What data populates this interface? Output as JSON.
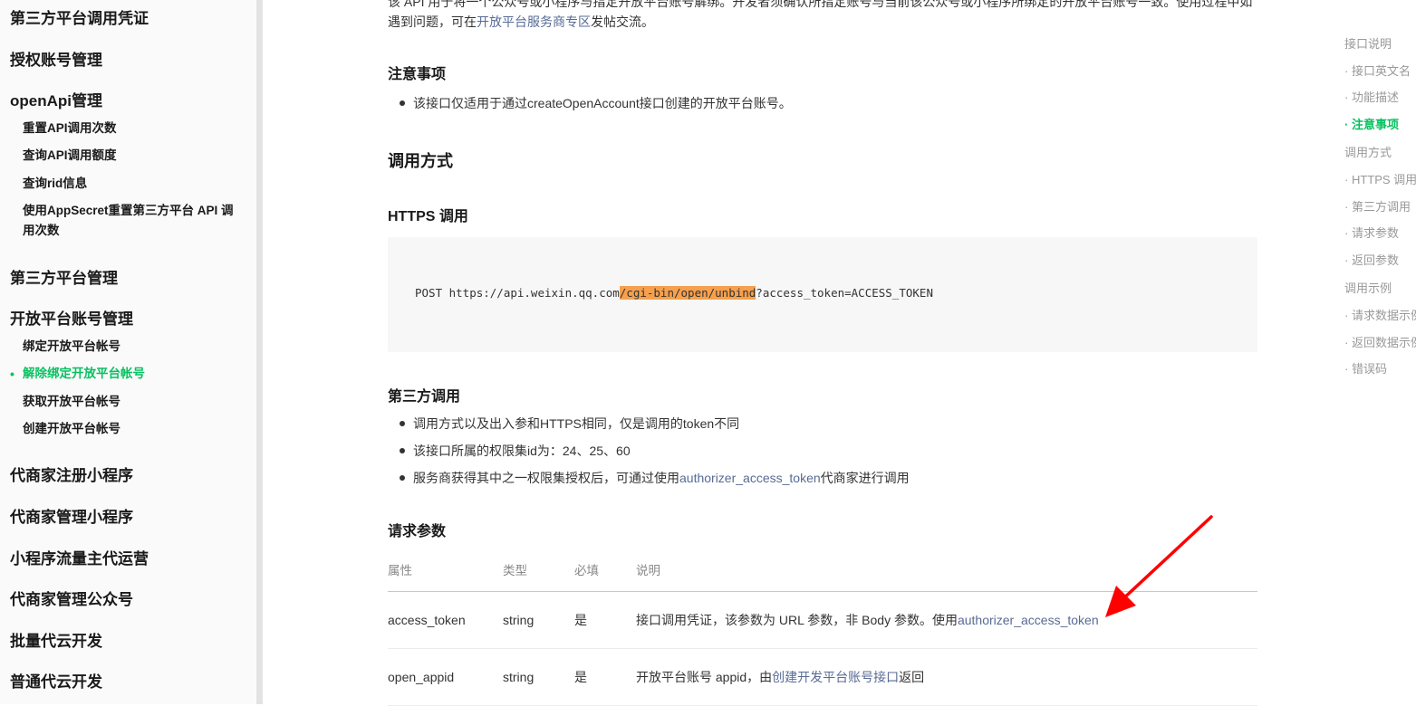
{
  "sidebar": {
    "sections": [
      {
        "label": "第三方平台调用凭证"
      },
      {
        "label": "授权账号管理"
      },
      {
        "label": "openApi管理"
      },
      {
        "label": "第三方平台管理"
      },
      {
        "label": "开放平台账号管理"
      },
      {
        "label": "代商家注册小程序"
      },
      {
        "label": "代商家管理小程序"
      },
      {
        "label": "小程序流量主代运营"
      },
      {
        "label": "代商家管理公众号"
      },
      {
        "label": "批量代云开发"
      },
      {
        "label": "普通代云开发"
      }
    ],
    "openapi_items": [
      {
        "label": "重置API调用次数"
      },
      {
        "label": "查询API调用额度"
      },
      {
        "label": "查询rid信息"
      },
      {
        "label": "使用AppSecret重置第三方平台 API 调用次数"
      }
    ],
    "open_account_items": [
      {
        "label": "绑定开放平台帐号"
      },
      {
        "label": "解除绑定开放平台帐号"
      },
      {
        "label": "获取开放平台帐号"
      },
      {
        "label": "创建开放平台帐号"
      }
    ]
  },
  "main": {
    "intro_line1": "该 API 用于将一个公众号或小程序与指定开放平台账号解绑。开发者须确认所指定账号与当前该公众号或小程序所绑定的开放平台账号一致。使用过程中如",
    "intro_line2_prefix": "遇到问题，可在",
    "intro_link": "开放平台服务商专区",
    "intro_line2_suffix": "发帖交流。",
    "notes_heading": "注意事项",
    "notes": [
      "该接口仅适用于通过createOpenAccount接口创建的开放平台账号。"
    ],
    "call_heading": "调用方式",
    "https_heading": "HTTPS 调用",
    "code": {
      "prefix": "POST https://api.weixin.qq.com",
      "highlight": "/cgi-bin/open/unbind",
      "suffix": "?access_token=ACCESS_TOKEN"
    },
    "third_heading": "第三方调用",
    "third_items": {
      "item1": "调用方式以及出入参和HTTPS相同，仅是调用的token不同",
      "item2": "该接口所属的权限集id为：24、25、60",
      "item3_prefix": "服务商获得其中之一权限集授权后，可通过使用",
      "item3_link": "authorizer_access_token",
      "item3_suffix": "代商家进行调用"
    },
    "params_heading": "请求参数",
    "table": {
      "headers": [
        "属性",
        "类型",
        "必填",
        "说明"
      ],
      "rows": [
        {
          "name": "access_token",
          "type": "string",
          "required": "是",
          "desc_prefix": "接口调用凭证，该参数为 URL 参数，非 Body 参数。使用",
          "desc_link": "authorizer_access_token",
          "desc_suffix": ""
        },
        {
          "name": "open_appid",
          "type": "string",
          "required": "是",
          "desc_prefix": "开放平台账号 appid，由",
          "desc_link": "创建开发平台账号接口",
          "desc_suffix": "返回"
        }
      ]
    }
  },
  "toc": {
    "items": [
      {
        "label": "接口说明"
      },
      {
        "label": "· 接口英文名"
      },
      {
        "label": "· 功能描述"
      },
      {
        "label": "· 注意事项"
      },
      {
        "label": "调用方式"
      },
      {
        "label": "· HTTPS 调用"
      },
      {
        "label": "· 第三方调用"
      },
      {
        "label": "· 请求参数"
      },
      {
        "label": "· 返回参数"
      },
      {
        "label": "调用示例"
      },
      {
        "label": "· 请求数据示例"
      },
      {
        "label": "· 返回数据示例"
      },
      {
        "label": "· 错误码"
      }
    ]
  },
  "colors": {
    "accent": "#07c160",
    "link": "#576b95",
    "highlight": "#f6a04d",
    "annotation": "#ff0000"
  },
  "active_toc_item": "· 注意事项",
  "active_nav_item": "解除绑定开放平台帐号"
}
